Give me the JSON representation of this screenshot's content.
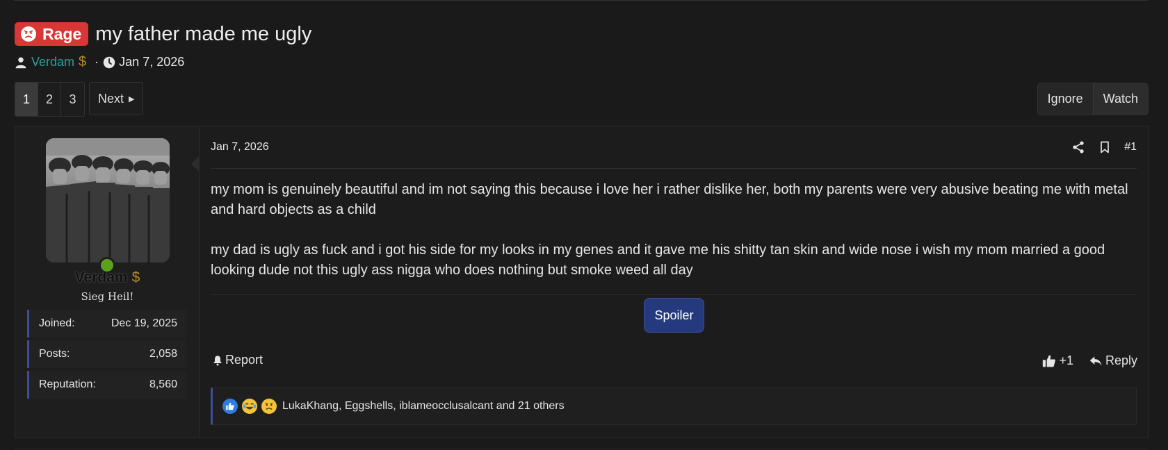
{
  "thread": {
    "prefix": "Rage",
    "title": "my father made me ugly",
    "author": "Verdam",
    "author_badge": "$",
    "separator": "·",
    "date": "Jan 7, 2026"
  },
  "pagination": {
    "pages": [
      "1",
      "2",
      "3"
    ],
    "active": "1",
    "next_label": "Next"
  },
  "thread_actions": {
    "ignore_label": "Ignore",
    "watch_label": "Watch"
  },
  "user": {
    "name": "Verdam",
    "badge": "$",
    "title": "Sieg Heil!",
    "status_color": "#5aa11d",
    "stats": [
      {
        "label": "Joined:",
        "value": "Dec 19, 2025"
      },
      {
        "label": "Posts:",
        "value": "2,058"
      },
      {
        "label": "Reputation:",
        "value": "8,560"
      }
    ]
  },
  "post": {
    "date": "Jan 7, 2026",
    "number": "#1",
    "paragraphs": [
      "my mom is genuinely beautiful and im not saying this because i love her i rather dislike her, both my parents were very abusive beating me with metal and hard objects as a child",
      "my dad is ugly as fuck and i got his side for my looks in my genes and it gave me his shitty tan skin and wide nose i wish my mom married a good looking dude not this ugly ass nigga who does nothing but smoke weed all day"
    ],
    "spoiler_label": "Spoiler",
    "report_label": "Report",
    "like_count": "+1",
    "reply_label": "Reply",
    "reactions_text": "LukaKhang, Eggshells, iblameocclusalcant and 21 others",
    "reaction_icons": [
      "like-emoji",
      "laugh-cry-emoji",
      "sad-emoji"
    ]
  },
  "colors": {
    "prefix_bg": "#d93636",
    "username": "#2aa198",
    "spoiler_bg": "#253a7e",
    "accent_border": "#3d4f9a"
  }
}
